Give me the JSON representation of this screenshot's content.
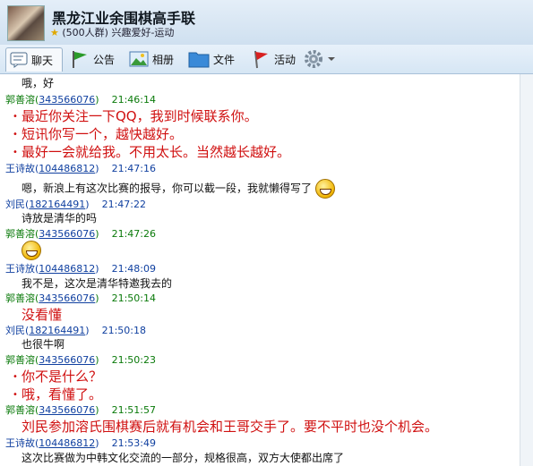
{
  "group": {
    "title": "黑龙江业余围棋高手联",
    "subtitle": "(500人群) 兴趣爱好-运动"
  },
  "toolbar": {
    "chat": "聊天",
    "notice": "公告",
    "album": "相册",
    "files": "文件",
    "activity": "活动"
  },
  "messages": [
    {
      "type": "text",
      "text": "哦，好"
    },
    {
      "type": "meta",
      "name": "郭善溶",
      "qq": "343566076",
      "time": "21:46:14",
      "color": "green"
    },
    {
      "type": "red",
      "text": "最近你关注一下QQ，我到时候联系你。"
    },
    {
      "type": "red",
      "text": "短讯你写一个，越快越好。"
    },
    {
      "type": "red",
      "text": "最好一会就给我。不用太长。当然越长越好。"
    },
    {
      "type": "meta",
      "name": "王诗故",
      "qq": "104486812",
      "time": "21:47:16",
      "color": "blue"
    },
    {
      "type": "text",
      "text": "嗯，新浪上有这次比赛的报导，你可以截一段，我就懒得写了"
    },
    {
      "type": "meta",
      "name": "刘民",
      "qq": "182164491",
      "time": "21:47:22",
      "color": "blue"
    },
    {
      "type": "text",
      "text": "诗放是清华的吗"
    },
    {
      "type": "meta",
      "name": "郭善溶",
      "qq": "343566076",
      "time": "21:47:26",
      "color": "green"
    },
    {
      "type": "meta",
      "name": "王诗放",
      "qq": "104486812",
      "time": "21:48:09",
      "color": "blue"
    },
    {
      "type": "text",
      "text": "我不是，这次是清华特邀我去的"
    },
    {
      "type": "meta",
      "name": "郭善溶",
      "qq": "343566076",
      "time": "21:50:14",
      "color": "green"
    },
    {
      "type": "red",
      "text": "没看懂"
    },
    {
      "type": "meta",
      "name": "刘民",
      "qq": "182164491",
      "time": "21:50:18",
      "color": "blue"
    },
    {
      "type": "text",
      "text": "也很牛啊"
    },
    {
      "type": "meta",
      "name": "郭善溶",
      "qq": "343566076",
      "time": "21:50:23",
      "color": "green"
    },
    {
      "type": "red",
      "text": "你不是什么？"
    },
    {
      "type": "red",
      "text": "哦，看懂了。"
    },
    {
      "type": "meta",
      "name": "郭善溶",
      "qq": "343566076",
      "time": "21:51:57",
      "color": "green"
    },
    {
      "type": "red",
      "text": "刘民参加溶氏围棋赛后就有机会和王哥交手了。要不平时也没个机会。"
    },
    {
      "type": "meta",
      "name": "王诗故",
      "qq": "104486812",
      "time": "21:53:49",
      "color": "blue"
    },
    {
      "type": "text",
      "text": "这次比赛做为中韩文化交流的一部分，规格很高，双方大使都出席了"
    }
  ],
  "icons": [
    "star-icon",
    "chat-icon",
    "flag-icon",
    "picture-icon",
    "folder-icon",
    "activity-flag-icon",
    "gear-icon",
    "chevron-down-icon",
    "smiley-icon"
  ],
  "colors": {
    "green_name": "#0a7a0a",
    "blue_name": "#1040a0",
    "red_text": "#d01010"
  }
}
